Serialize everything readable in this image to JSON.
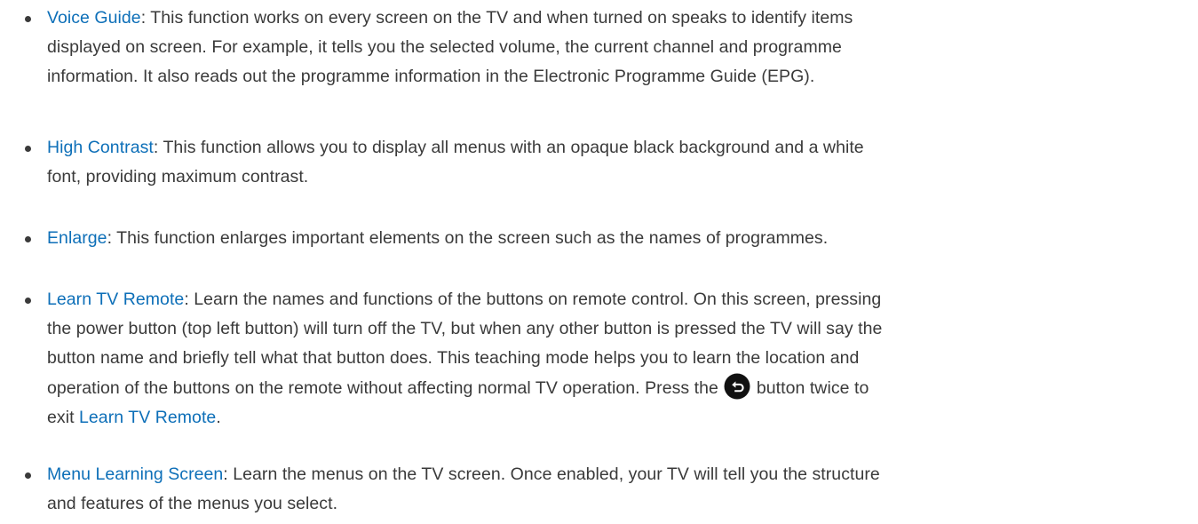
{
  "items": [
    {
      "term": "Voice Guide",
      "lines": [
        ": This function works on every screen on the TV and when turned on speaks to identify items",
        "displayed on screen. For example, it tells you the selected volume, the current channel and programme",
        "information. It also reads out the programme information in the Electronic Programme Guide (EPG)."
      ]
    },
    {
      "term": "High Contrast",
      "lines": [
        ": This function allows you to display all menus with an opaque black background and a white",
        "font, providing maximum contrast."
      ]
    },
    {
      "term": "Enlarge",
      "lines": [
        ": This function enlarges important elements on the screen such as the names of programmes."
      ]
    },
    {
      "term": "Learn TV Remote",
      "lines": [
        ": Learn the names and functions of the buttons on remote control. On this screen, pressing",
        "the power button (top left button) will turn off the TV, but when any other button is pressed the TV will say the",
        "button name and briefly tell what that button does. This teaching mode helps you to learn the location and",
        "operation of the buttons on the remote without affecting normal TV operation. Press the",
        "button twice to",
        "exit",
        "."
      ],
      "icon": "return-button-icon",
      "term_repeat": "Learn TV Remote"
    },
    {
      "term": "Menu Learning Screen",
      "lines": [
        ": Learn the menus on the TV screen. Once enabled, your TV will tell you the structure",
        "and features of the menus you select."
      ]
    }
  ]
}
